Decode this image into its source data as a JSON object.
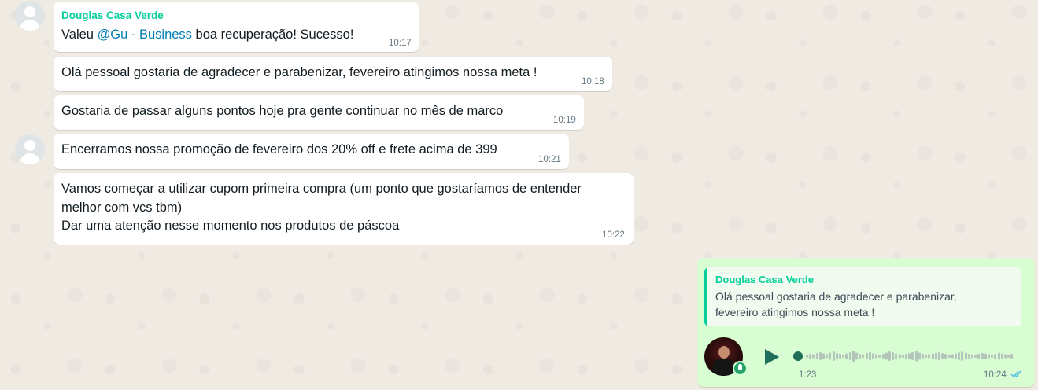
{
  "messages": [
    {
      "sender": "Douglas Casa Verde",
      "pre": "Valeu ",
      "mention": "@Gu - Business",
      "post": "  boa recuperação! Sucesso!",
      "time": "10:17"
    },
    {
      "text": "Olá pessoal gostaria de agradecer e parabenizar, fevereiro atingimos nossa meta !",
      "time": "10:18"
    },
    {
      "text": "Gostaria de passar alguns  pontos hoje pra gente continuar no mês de marco",
      "time": "10:19"
    },
    {
      "text": "Encerramos nossa promoção de fevereiro dos 20% off e frete acima de 399",
      "time": "10:21"
    },
    {
      "lines": [
        "Vamos começar a utilizar cupom primeira compra (um ponto que gostaríamos de entender",
        "melhor com vcs tbm)",
        "Dar uma atenção nesse momento nos produtos de páscoa"
      ],
      "time": "10:22"
    }
  ],
  "outgoing": {
    "quote_sender": "Douglas Casa Verde",
    "quote_text": "Olá pessoal gostaria de agradecer e parabenizar, fevereiro atingimos nossa meta !",
    "voice_duration": "1:23",
    "time": "10:24",
    "status": "read"
  },
  "colors": {
    "background": "#efeae2",
    "incoming_bubble": "#ffffff",
    "outgoing_bubble": "#d9fdd3",
    "sender_name": "#06cf9c",
    "mention": "#027eb5",
    "read_ticks": "#53bdeb"
  }
}
